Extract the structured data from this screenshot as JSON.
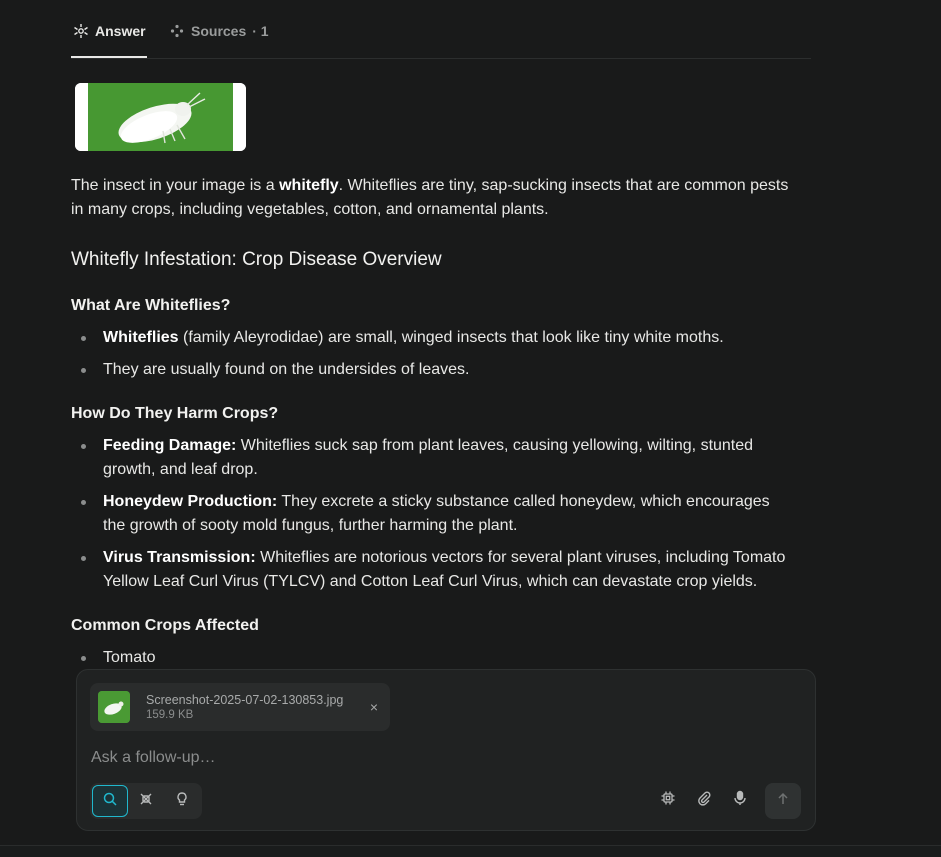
{
  "tabs": {
    "answer_label": "Answer",
    "sources_label": "Sources",
    "sources_count": "· 1"
  },
  "answer": {
    "intro_prefix": "The insect in your image is a ",
    "intro_bold": "whitefly",
    "intro_suffix": ". Whiteflies are tiny, sap-sucking insects that are common pests in many crops, including vegetables, cotton, and ornamental plants.",
    "heading": "Whitefly Infestation: Crop Disease Overview",
    "sections": [
      {
        "title": "What Are Whiteflies?",
        "items": [
          {
            "bold": "Whiteflies",
            "text": " (family Aleyrodidae) are small, winged insects that look like tiny white moths."
          },
          {
            "bold": "",
            "text": "They are usually found on the undersides of leaves."
          }
        ]
      },
      {
        "title": "How Do They Harm Crops?",
        "items": [
          {
            "bold": "Feeding Damage:",
            "text": " Whiteflies suck sap from plant leaves, causing yellowing, wilting, stunted growth, and leaf drop."
          },
          {
            "bold": "Honeydew Production:",
            "text": " They excrete a sticky substance called honeydew, which encourages the growth of sooty mold fungus, further harming the plant."
          },
          {
            "bold": "Virus Transmission:",
            "text": " Whiteflies are notorious vectors for several plant viruses, including Tomato Yellow Leaf Curl Virus (TYLCV) and Cotton Leaf Curl Virus, which can devastate crop yields."
          }
        ]
      },
      {
        "title": "Common Crops Affected",
        "items": [
          {
            "bold": "",
            "text": "Tomato"
          }
        ]
      }
    ]
  },
  "composer": {
    "attachment_name": "Screenshot-2025-07-02-130853.jpg",
    "attachment_size": "159.9 KB",
    "attachment_close": "×",
    "placeholder": "Ask a follow-up…",
    "modes": [
      "search-icon",
      "reasoning-icon",
      "lightbulb-icon"
    ],
    "right_icons": [
      "chip-icon",
      "paperclip-icon",
      "microphone-icon"
    ],
    "send_icon": "arrow-up-icon"
  },
  "colors": {
    "background": "#191a1a",
    "accent": "#20b8cd",
    "text": "#e8e8e6"
  }
}
